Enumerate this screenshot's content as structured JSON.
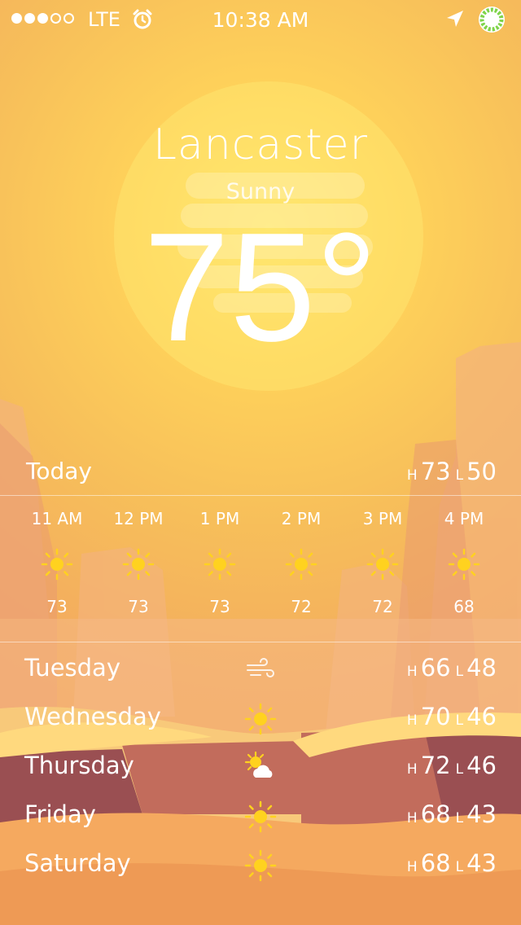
{
  "status_bar": {
    "signal_bars_filled": 3,
    "signal_bars_total": 5,
    "carrier": "LTE",
    "time": "10:38 AM",
    "icons": [
      "alarm-icon",
      "location-icon",
      "battery-ring-icon"
    ],
    "battery_color": "#7fd44a"
  },
  "current": {
    "city": "Lancaster",
    "condition": "Sunny",
    "temperature": "75°"
  },
  "today": {
    "label": "Today",
    "high_prefix": "H",
    "high": "73",
    "low_prefix": "L",
    "low": "50"
  },
  "hourly": [
    {
      "time": "11 AM",
      "icon": "sun-icon",
      "temp": "73"
    },
    {
      "time": "12 PM",
      "icon": "sun-icon",
      "temp": "73"
    },
    {
      "time": "1 PM",
      "icon": "sun-icon",
      "temp": "73"
    },
    {
      "time": "2 PM",
      "icon": "sun-icon",
      "temp": "72"
    },
    {
      "time": "3 PM",
      "icon": "sun-icon",
      "temp": "72"
    },
    {
      "time": "4 PM",
      "icon": "sun-icon",
      "temp": "68"
    }
  ],
  "daily": [
    {
      "day": "Tuesday",
      "icon": "wind-icon",
      "high_prefix": "H",
      "high": "66",
      "low_prefix": "L",
      "low": "48"
    },
    {
      "day": "Wednesday",
      "icon": "sun-icon",
      "high_prefix": "H",
      "high": "70",
      "low_prefix": "L",
      "low": "46"
    },
    {
      "day": "Thursday",
      "icon": "partly-cloudy-icon",
      "high_prefix": "H",
      "high": "72",
      "low_prefix": "L",
      "low": "46"
    },
    {
      "day": "Friday",
      "icon": "sun-icon",
      "high_prefix": "H",
      "high": "68",
      "low_prefix": "L",
      "low": "43"
    },
    {
      "day": "Saturday",
      "icon": "sun-icon",
      "high_prefix": "H",
      "high": "68",
      "low_prefix": "L",
      "low": "43"
    }
  ],
  "colors": {
    "sky_center": "#ffe56a",
    "sky_edge": "#f29d58",
    "sun_icon": "#ffd21f",
    "canyon_dark": "#9a4f52",
    "sand": "#f7b766"
  }
}
